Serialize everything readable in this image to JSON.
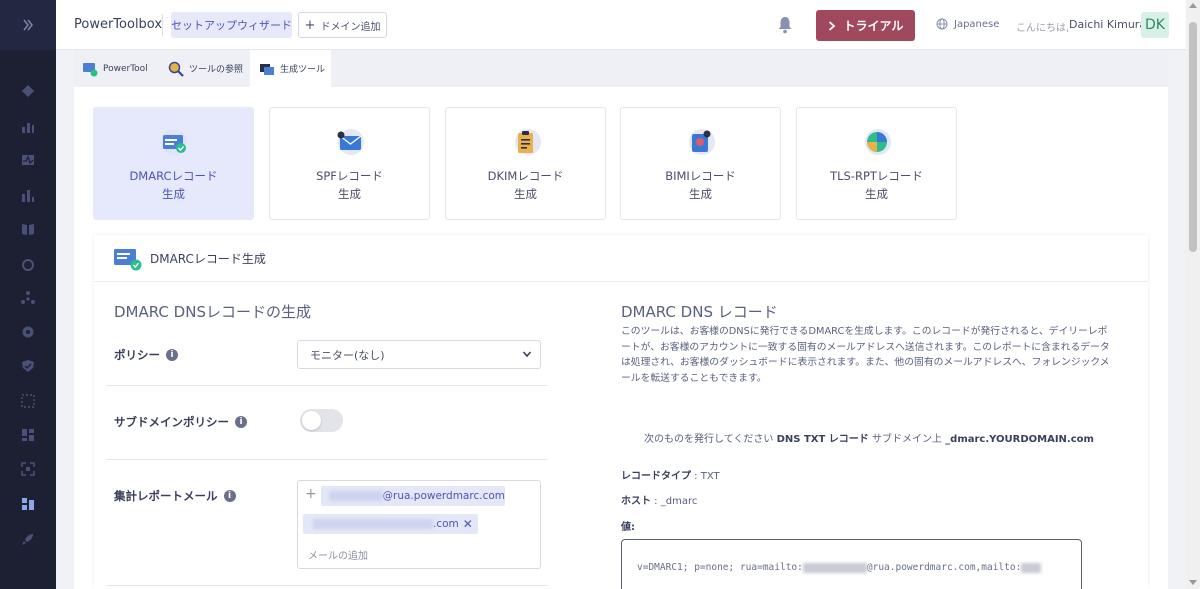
{
  "header": {
    "brand": "PowerToolbox",
    "wizard_label": "セットアップウィザード",
    "add_domain_label": "ドメイン追加",
    "trial_label": "トライアル",
    "language": "Japanese",
    "greeting": "こんにちは,",
    "user_name": "Daichi Kimura",
    "avatar_initials": "DK"
  },
  "tabs": [
    {
      "label": "PowerTool"
    },
    {
      "label": "ツールの参照"
    },
    {
      "label": "生成ツール"
    }
  ],
  "cards": [
    {
      "label": "DMARCレコード\n生成",
      "icon": "dmarc-icon"
    },
    {
      "label": "SPFレコード\n生成",
      "icon": "spf-icon"
    },
    {
      "label": "DKIMレコード\n生成",
      "icon": "dkim-icon"
    },
    {
      "label": "BIMIレコード\n生成",
      "icon": "bimi-icon"
    },
    {
      "label": "TLS-RPTレコード\n生成",
      "icon": "tls-rpt-icon"
    }
  ],
  "section": {
    "title": "DMARCレコード生成",
    "form_title": "DMARC DNSレコードの生成",
    "policy_label": "ポリシー",
    "policy_value": "モニター(なし)",
    "subdomain_policy_label": "サブドメインポリシー",
    "aggregate_label": "集計レポートメール",
    "email_1_suffix": "@rua.powerdmarc.com",
    "email_2_suffix": ".com",
    "add_email_placeholder": "メールの追加"
  },
  "record": {
    "title": "DMARC DNS レコード",
    "description": "このツールは、お客様のDNSに発行できるDMARCを生成します。このレコードが発行されると、デイリーレポートが、お客様のアカウントに一致する固有のメールアドレスへ送信されます。このレポートに含まれるデータは処理され、お客様のダッシュボードに表示されます。また、他の固有のメールアドレスへ、フォレンジックメールを転送することもできます。",
    "publish_prefix": "次のものを発行してください",
    "publish_type": "DNS TXT レコード",
    "publish_mid": "サブドメイン上",
    "publish_host": "_dmarc.YOURDOMAIN.com",
    "type_label": "レコードタイプ",
    "type_value": " : TXT",
    "host_label": "ホスト",
    "host_value": " : _dmarc",
    "value_label": "値:",
    "value_prefix": "v=DMARC1; p=none; rua=mailto:",
    "value_mid": "@rua.powerdmarc.com,mailto:"
  }
}
